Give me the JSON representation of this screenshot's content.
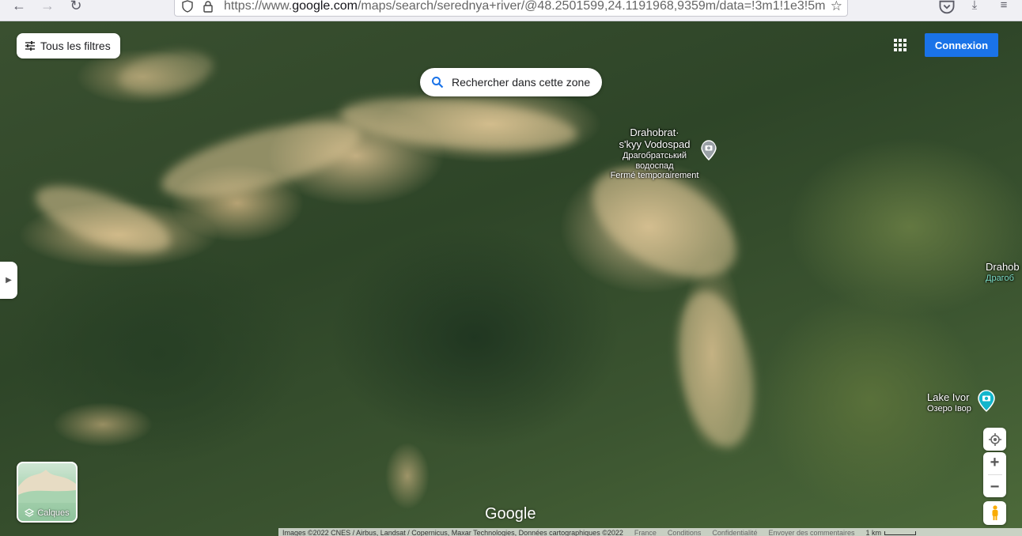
{
  "browser": {
    "url_prefix": "https://www.",
    "url_domain": "google.com",
    "url_rest": "/maps/search/serednya+river/@48.2501599,24.1191968,9359m/data=!3m1!1e3!5m"
  },
  "map": {
    "filters_label": "Tous les filtres",
    "search_area_label": "Rechercher dans cette zone",
    "signin_label": "Connexion",
    "layers_label": "Calques",
    "google_logo": "Google",
    "places": [
      {
        "name_line1": "Drahobrat·",
        "name_line2": "s'kyy Vodospad",
        "local_name_line1": "Драгобратський",
        "local_name_line2": "водоспад",
        "status": "Fermé temporairement"
      },
      {
        "name": "Lake Ivor",
        "local_name": "Озеро Івор"
      },
      {
        "name": "Drahob",
        "local_name": "Драгоб"
      }
    ],
    "footer": {
      "attribution": "Images ©2022 CNES / Airbus, Landsat / Copernicus, Maxar Technologies, Données cartographiques ©2022",
      "links": [
        "France",
        "Conditions",
        "Confidentialité",
        "Envoyer des commentaires"
      ],
      "scale": "1 km"
    }
  }
}
